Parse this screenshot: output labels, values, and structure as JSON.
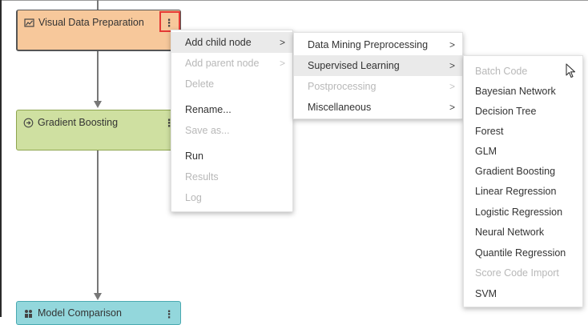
{
  "nodes": {
    "visual_data_preparation": {
      "label": "Visual Data Preparation",
      "icon": "data-prep-icon",
      "color": "#f7c89b"
    },
    "gradient_boosting": {
      "label": "Gradient Boosting",
      "icon": "arrow-circle-icon",
      "color": "#cfe0a1"
    },
    "model_comparison": {
      "label": "Model Comparison",
      "icon": "compare-icon",
      "color": "#93d7dc"
    }
  },
  "kebab_glyph": "⋮",
  "context_menu": {
    "items": [
      {
        "label": "Add child node",
        "disabled": false,
        "submenu": true,
        "active": true
      },
      {
        "label": "Add parent node",
        "disabled": true,
        "submenu": true
      },
      {
        "label": "Delete",
        "disabled": true
      },
      {
        "label": "Rename...",
        "disabled": false
      },
      {
        "label": "Save as...",
        "disabled": true
      },
      {
        "label": "Run",
        "disabled": false
      },
      {
        "label": "Results",
        "disabled": true
      },
      {
        "label": "Log",
        "disabled": true
      }
    ]
  },
  "child_node_menu": {
    "items": [
      {
        "label": "Data Mining Preprocessing",
        "disabled": false,
        "submenu": true
      },
      {
        "label": "Supervised Learning",
        "disabled": false,
        "submenu": true,
        "active": true
      },
      {
        "label": "Postprocessing",
        "disabled": true,
        "submenu": true
      },
      {
        "label": "Miscellaneous",
        "disabled": false,
        "submenu": true
      }
    ]
  },
  "supervised_learning_menu": {
    "items": [
      {
        "label": "Batch Code",
        "disabled": true
      },
      {
        "label": "Bayesian Network",
        "disabled": false
      },
      {
        "label": "Decision Tree",
        "disabled": false
      },
      {
        "label": "Forest",
        "disabled": false
      },
      {
        "label": "GLM",
        "disabled": false
      },
      {
        "label": "Gradient Boosting",
        "disabled": false
      },
      {
        "label": "Linear Regression",
        "disabled": false
      },
      {
        "label": "Logistic Regression",
        "disabled": false
      },
      {
        "label": "Neural Network",
        "disabled": false
      },
      {
        "label": "Quantile Regression",
        "disabled": false
      },
      {
        "label": "Score Code Import",
        "disabled": true
      },
      {
        "label": "SVM",
        "disabled": false
      }
    ]
  },
  "chevron_glyph": ">",
  "colors": {
    "highlight": "#e53935",
    "menu_active": "#eaeaea",
    "disabled_text": "#b8b8b8"
  }
}
